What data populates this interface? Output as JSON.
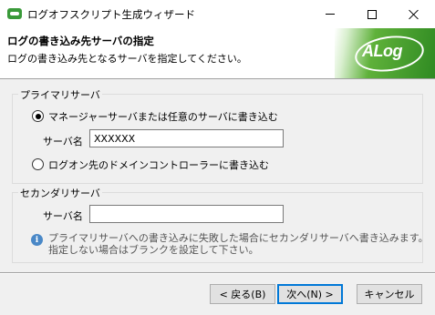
{
  "window": {
    "title": "ログオフスクリプト生成ウィザード",
    "app_icon": "alog-app-icon"
  },
  "header": {
    "title": "ログの書き込み先サーバの指定",
    "subtitle": "ログの書き込み先となるサーバを指定してください。",
    "logo_text": "ALog",
    "logo_color": "#2f8a22"
  },
  "primary": {
    "legend": "プライマリサーバ",
    "option1_label": "マネージャーサーバまたは任意のサーバに書き込む",
    "option1_selected": true,
    "server_label": "サーバ名",
    "server_value": "XXXXXX",
    "option2_label": "ログオン先のドメインコントローラーに書き込む",
    "option2_selected": false
  },
  "secondary": {
    "legend": "セカンダリサーバ",
    "server_label": "サーバ名",
    "server_value": "",
    "info_line1": "プライマリサーバへの書き込みに失敗した場合にセカンダリサーバへ書き込みます。",
    "info_line2": "指定しない場合はブランクを設定して下さい。"
  },
  "buttons": {
    "back": "< 戻る(B)",
    "next": "次へ(N) >",
    "cancel": "キャンセル"
  }
}
